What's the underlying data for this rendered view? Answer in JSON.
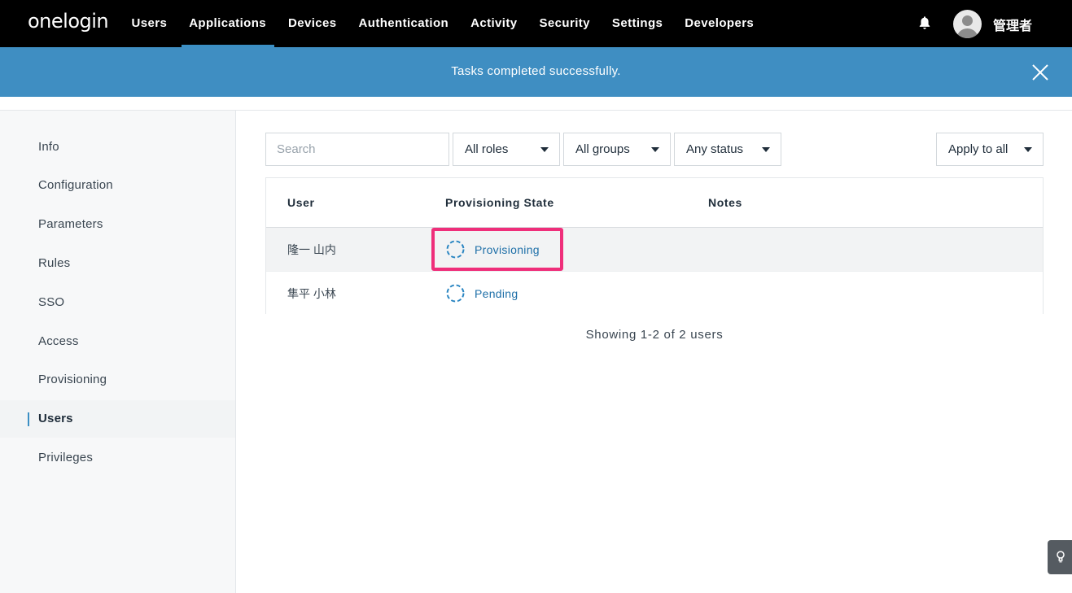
{
  "nav": {
    "logo": "onelogin",
    "links": [
      "Users",
      "Applications",
      "Devices",
      "Authentication",
      "Activity",
      "Security",
      "Settings",
      "Developers"
    ],
    "active": "Applications",
    "username": "管理者",
    "accent": "#3b8fc4"
  },
  "banner": {
    "message": "Tasks completed successfully.",
    "color": "#3f8ec2"
  },
  "sidebar": {
    "items": [
      "Info",
      "Configuration",
      "Parameters",
      "Rules",
      "SSO",
      "Access",
      "Provisioning",
      "Users",
      "Privileges"
    ],
    "active": "Users"
  },
  "filters": {
    "search_placeholder": "Search",
    "roles": "All roles",
    "groups": "All groups",
    "status": "Any status",
    "apply": "Apply to all"
  },
  "table": {
    "columns": [
      "User",
      "Provisioning State",
      "Notes"
    ],
    "rows": [
      {
        "user": "隆一 山内",
        "state": "Provisioning",
        "notes": ""
      },
      {
        "user": "隼平 小林",
        "state": "Pending",
        "notes": ""
      }
    ]
  },
  "footer": {
    "showing": "Showing 1-2 of 2 users"
  },
  "icons": {
    "notifications": "bell-icon",
    "close": "close-icon",
    "status": "dashed-circle-icon",
    "help": "lightbulb-icon"
  },
  "highlight_color": "#ef2e7a"
}
